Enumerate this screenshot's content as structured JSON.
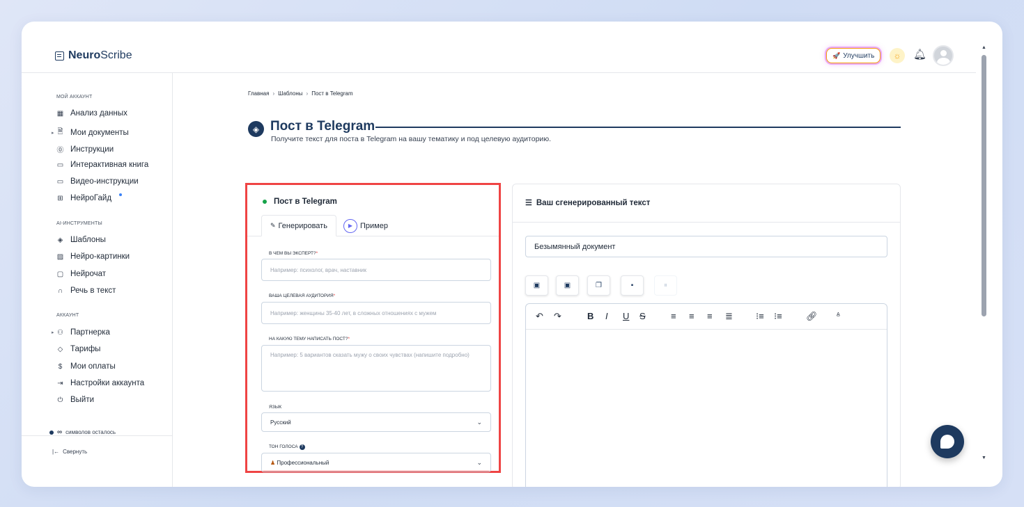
{
  "header": {
    "logo_bold": "Neuro",
    "logo_rest": "Scribe",
    "upgrade_label": "Улучшить"
  },
  "sidebar": {
    "section_account": "МОЙ АККАУНТ",
    "account_items": [
      {
        "label": "Анализ данных",
        "icon": "grid-icon"
      },
      {
        "label": "Мои документы",
        "icon": "document-icon"
      },
      {
        "label": "Инструкции",
        "icon": "help-circle-icon"
      },
      {
        "label": "Интерактивная книга",
        "icon": "book-icon"
      },
      {
        "label": "Видео-инструкции",
        "icon": "video-icon"
      },
      {
        "label": "НейроГайд",
        "icon": "guide-icon"
      }
    ],
    "section_ai": "AI-ИНСТРУМЕНТЫ",
    "ai_items": [
      {
        "label": "Шаблоны",
        "icon": "layers-icon"
      },
      {
        "label": "Нейро-картинки",
        "icon": "image-icon"
      },
      {
        "label": "Нейрочат",
        "icon": "chat-icon"
      },
      {
        "label": "Речь в текст",
        "icon": "headphones-icon"
      }
    ],
    "section_acc": "АККАУНТ",
    "acc_items": [
      {
        "label": "Партнерка",
        "icon": "users-icon"
      },
      {
        "label": "Тарифы",
        "icon": "tag-icon"
      },
      {
        "label": "Мои оплаты",
        "icon": "dollar-icon"
      },
      {
        "label": "Настройки аккаунта",
        "icon": "login-icon"
      },
      {
        "label": "Выйти",
        "icon": "power-icon"
      }
    ],
    "symbols_count": "∞",
    "symbols_label": "символов осталось",
    "collapse_label": "Свернуть"
  },
  "breadcrumb": [
    "Главная",
    "Шаблоны",
    "Пост в Telegram"
  ],
  "page": {
    "title": "Пост в Telegram",
    "subtitle": "Получите текст для поста в Telegram на вашу тематику и под целевую аудиторию."
  },
  "form": {
    "title": "Пост в Telegram",
    "tab_generate": "Генерировать",
    "tab_example": "Пример",
    "field1_label": "В ЧЕМ ВЫ ЭКСПЕРТ?",
    "field1_placeholder": "Например: психолог, врач, наставник",
    "field2_label": "ВАША ЦЕЛЕВАЯ АУДИТОРИЯ",
    "field2_placeholder": "Например: женщины 35-40 лет, в сложных отношениях с мужем",
    "field3_label": "НА КАКУЮ ТЕМУ НАПИСАТЬ ПОСТ?",
    "field3_placeholder": "Например: 5 вариантов сказать мужу о своих чувствах (напишите подробно)",
    "language_label": "ЯЗЫК",
    "language_value": "Русский",
    "tone_label": "ТОН ГОЛОСА",
    "tone_value": "Профессиональный",
    "required_mark": "*"
  },
  "result": {
    "title": "Ваш сгенерированный текст",
    "doc_name": "Безымянный документ"
  },
  "colors": {
    "brand": "#1e3a5f",
    "highlight_border": "#ef4444",
    "status_dot": "#16a34a"
  }
}
